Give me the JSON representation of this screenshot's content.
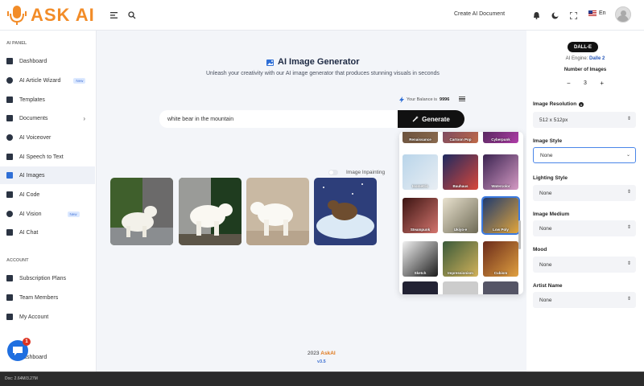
{
  "app": {
    "logo_text": "ASK AI"
  },
  "topbar": {
    "create_doc": "Create AI Document",
    "lang": "En"
  },
  "sidebar": {
    "section1": "AI PANEL",
    "items": [
      {
        "label": "Dashboard"
      },
      {
        "label": "AI Article Wizard",
        "badge": "New"
      },
      {
        "label": "Templates"
      },
      {
        "label": "Documents"
      },
      {
        "label": "AI Voiceover"
      },
      {
        "label": "AI Speech to Text"
      },
      {
        "label": "AI Images"
      },
      {
        "label": "AI Code"
      },
      {
        "label": "AI Vision",
        "badge": "New"
      },
      {
        "label": "AI Chat"
      }
    ],
    "section2": "ACCOUNT",
    "account_items": [
      {
        "label": "Subscription Plans"
      },
      {
        "label": "Team Members"
      },
      {
        "label": "My Account"
      },
      {
        "label": "Dashboard"
      }
    ],
    "chat_badge": "1"
  },
  "main": {
    "title": "AI Image Generator",
    "subtitle": "Unleash your creativity with our AI image generator that produces stunning visuals in seconds",
    "balance_label": "Your Balance is",
    "balance_value": "9996",
    "prompt_value": "white bear in the mountain",
    "generate_label": "Generate",
    "inpainting_label": "Image Inpainting",
    "footer_year": "2023",
    "footer_brand": "AskAI",
    "footer_version": "v3.5"
  },
  "style_popup": {
    "close": "×",
    "tiles": [
      {
        "label": "Renaissance"
      },
      {
        "label": "Cartoon Pop"
      },
      {
        "label": "Cyberpunk"
      },
      {
        "label": "Isometric"
      },
      {
        "label": "Bauhaus"
      },
      {
        "label": "Watercolor"
      },
      {
        "label": "Steampunk"
      },
      {
        "label": "Ukiyo-e"
      },
      {
        "label": "Low Poly"
      },
      {
        "label": "Sketch"
      },
      {
        "label": "Impressionism"
      },
      {
        "label": "Cubism"
      }
    ]
  },
  "right_panel": {
    "dalle_label": "DALL-E",
    "engine_label": "AI Engine:",
    "engine_value": "Dalle 2",
    "num_images_label": "Number of Images",
    "num_images_value": "3",
    "minus": "−",
    "plus": "+",
    "fields": [
      {
        "label": "Image Resolution",
        "value": "512 x 512px"
      },
      {
        "label": "Image Style",
        "value": "None"
      },
      {
        "label": "Lighting Style",
        "value": "None"
      },
      {
        "label": "Image Medium",
        "value": "None"
      },
      {
        "label": "Mood",
        "value": "None"
      },
      {
        "label": "Artist Name",
        "value": "None"
      }
    ]
  },
  "taskbar": {
    "status": "Doc: 2.64M/3.27M"
  }
}
